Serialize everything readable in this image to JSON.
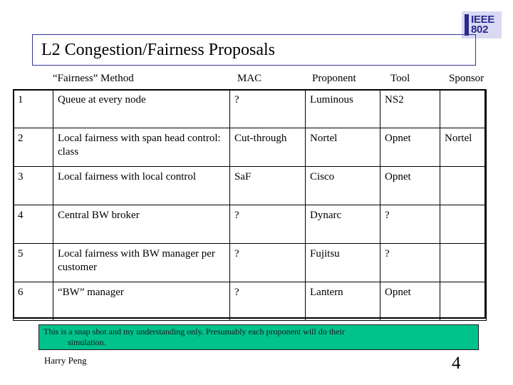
{
  "logo": {
    "line1": "IEEE",
    "line2": "802",
    "color": "#2a2a8c",
    "background": "#d9d9f2"
  },
  "title": {
    "text": "L2 Congestion/Fairness Proposals",
    "border_color": "#333399"
  },
  "table": {
    "headers": {
      "number": "",
      "method": "“Fairness” Method",
      "mac": "MAC",
      "proponent": "Proponent",
      "tool": "Tool",
      "sponsor": "Sponsor"
    },
    "rows": [
      {
        "number": "1",
        "method": "Queue at every node",
        "mac": "?",
        "proponent": "Luminous",
        "tool": "NS2",
        "sponsor": ""
      },
      {
        "number": "2",
        "method": "Local fairness with span head control: class",
        "mac": "Cut-through",
        "proponent": "Nortel",
        "tool": "Opnet",
        "sponsor": "Nortel"
      },
      {
        "number": "3",
        "method": "Local fairness with local control",
        "mac": "SaF",
        "proponent": "Cisco",
        "tool": "Opnet",
        "sponsor": ""
      },
      {
        "number": "4",
        "method": "Central BW broker",
        "mac": "?",
        "proponent": "Dynarc",
        "tool": "?",
        "sponsor": ""
      },
      {
        "number": "5",
        "method": "Local fairness with BW manager per customer",
        "mac": "?",
        "proponent": "Fujitsu",
        "tool": "?",
        "sponsor": ""
      },
      {
        "number": "6",
        "method": "“BW” manager",
        "mac": "?",
        "proponent": "Lantern",
        "tool": "Opnet",
        "sponsor": ""
      }
    ]
  },
  "note": {
    "line1": "This is a snap shot and my understanding only. Presumably each proponent will do their",
    "line2": "simulation.",
    "background": "#00C28C"
  },
  "footer": {
    "author": "Harry Peng",
    "page_number": "4"
  }
}
